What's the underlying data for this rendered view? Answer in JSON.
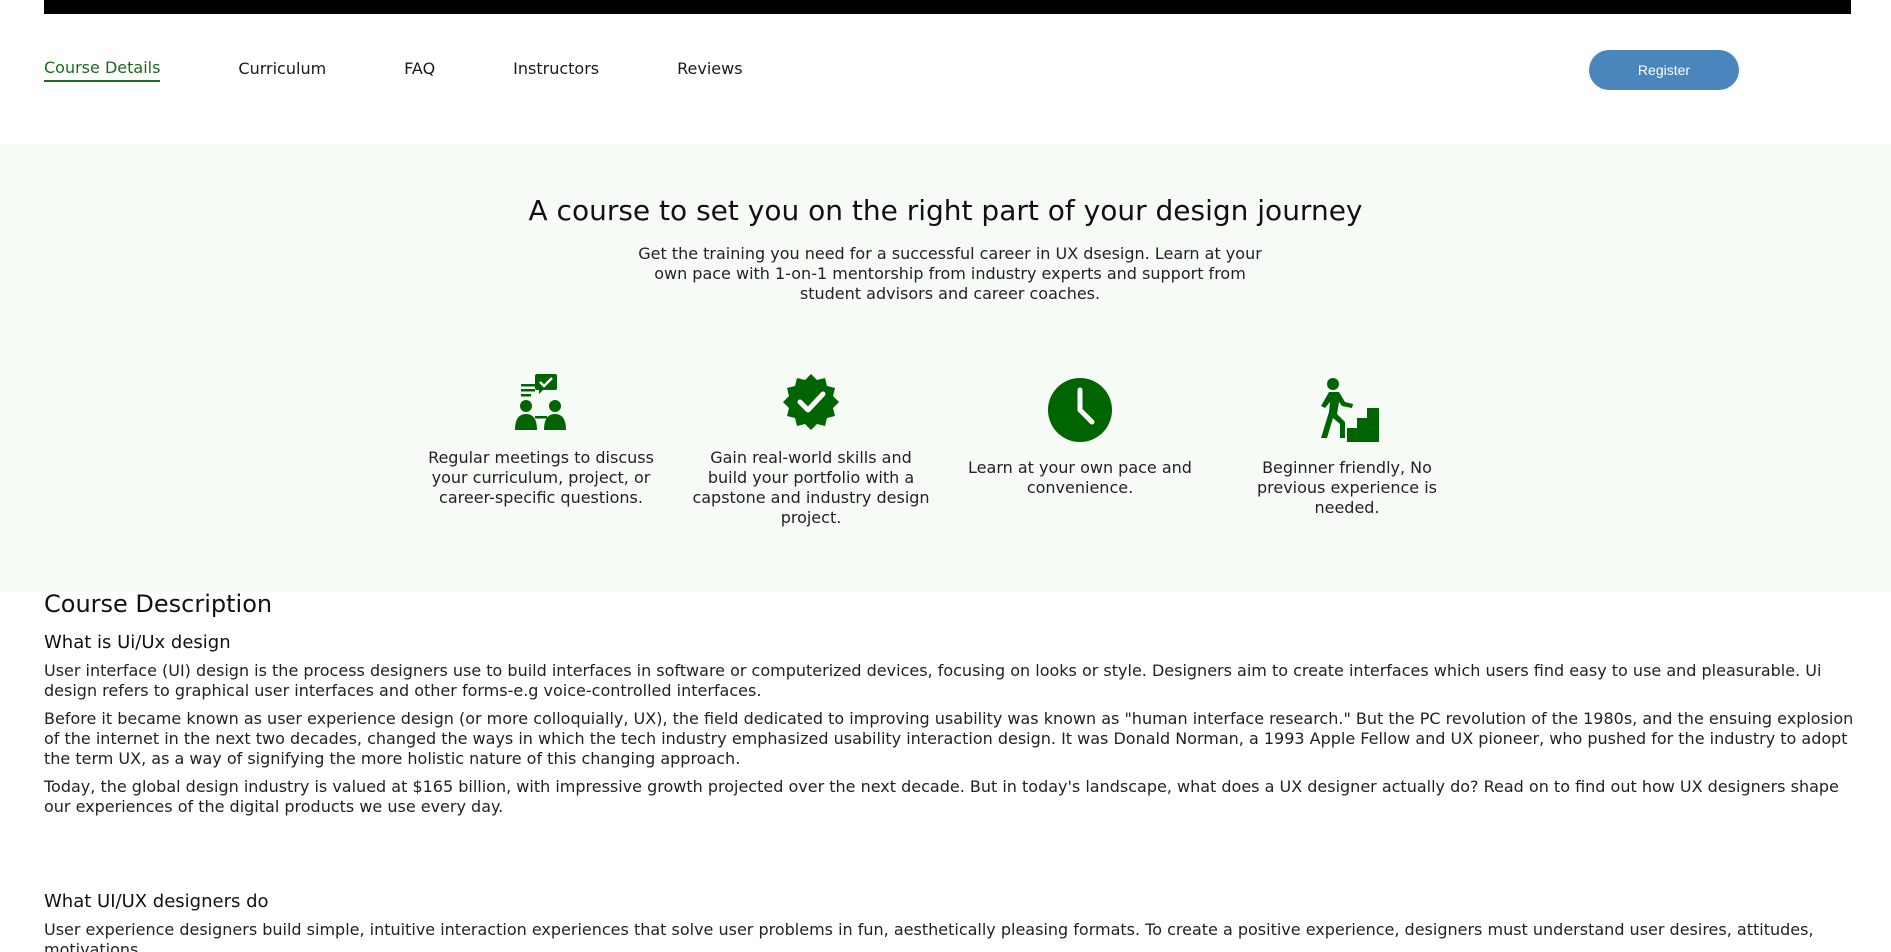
{
  "nav": {
    "items": [
      {
        "label": "Course Details"
      },
      {
        "label": "Curriculum"
      },
      {
        "label": "FAQ"
      },
      {
        "label": "Instructors"
      },
      {
        "label": "Reviews"
      }
    ],
    "register_label": "Register"
  },
  "hero": {
    "title": "A course to set you on the right part of your design journey",
    "subtitle": "Get the training you need for a successful career in UX dsesign. Learn at your own pace with 1-on-1 mentorship from industry experts and support from student advisors and career coaches."
  },
  "features": [
    {
      "icon": "mentorship-meeting-icon",
      "text": "Regular meetings to discuss your curriculum, project, or career-specific questions."
    },
    {
      "icon": "verified-badge-icon",
      "text": "Gain real-world skills and build your portfolio with a capstone and industry design project."
    },
    {
      "icon": "clock-icon",
      "text": "Learn at your own pace and convenience."
    },
    {
      "icon": "stairs-climber-icon",
      "text": "Beginner friendly, No previous experience is needed."
    }
  ],
  "colors": {
    "accent_green": "#006400",
    "register_blue": "#4a86bb",
    "hero_bg": "#f6fcf5"
  },
  "description": {
    "heading": "Course Description",
    "section1": {
      "title": "What is Ui/Ux design",
      "paragraphs": [
        "User interface (UI) design is the process designers use to build interfaces in software or computerized devices, focusing on looks or style. Designers aim to create interfaces which users find easy to use and pleasurable. Ui design refers to graphical user interfaces and other forms-e.g voice-controlled interfaces.",
        "Before it became known as user experience design (or more colloquially, UX), the field dedicated to improving usability was known as \"human interface research.\" But the PC revolution of the 1980s, and the ensuing explosion of the internet in the next two decades, changed the ways in which the tech industry emphasized usability interaction design. It was Donald Norman, a 1993 Apple Fellow and UX pioneer, who pushed for the industry to adopt the term UX, as a way of signifying the more holistic nature of this changing approach.",
        "Today, the global design industry is valued at $165 billion, with impressive growth projected over the next decade. But in today's landscape, what does a UX designer actually do? Read on to find out how UX designers shape our experiences of the digital products we use every day."
      ]
    },
    "section2": {
      "title": "What UI/UX designers do",
      "paragraphs": [
        "User experience designers build simple, intuitive interaction experiences that solve user problems in fun, aesthetically pleasing formats. To create a positive experience, designers must understand user desires, attitudes, motivations,"
      ]
    }
  }
}
